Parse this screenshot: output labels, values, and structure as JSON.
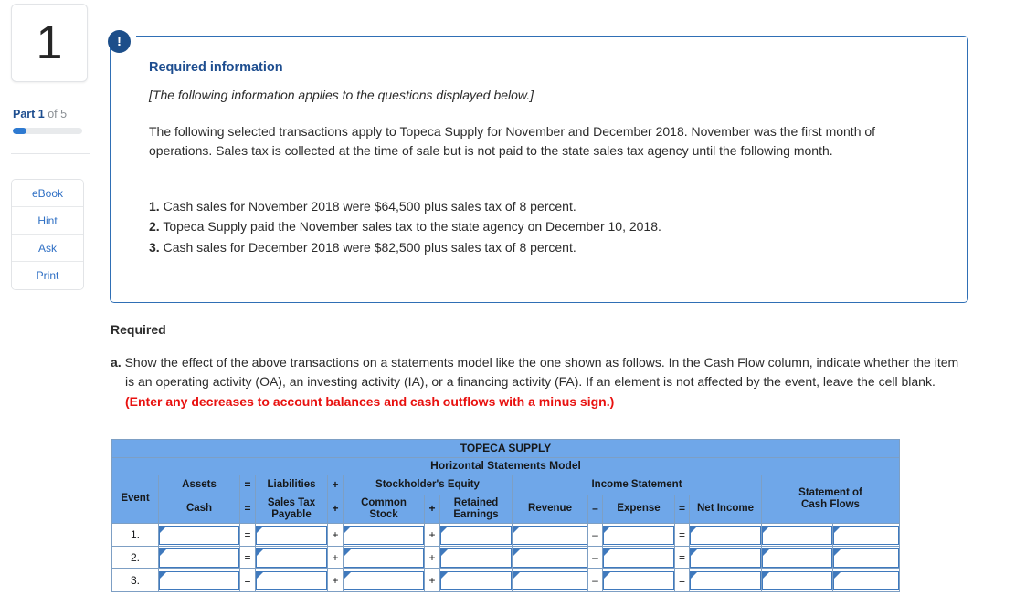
{
  "sidebar": {
    "question_number": "1",
    "part_prefix": "Part 1",
    "part_suffix": " of 5",
    "progress_percent": 20,
    "tools": [
      {
        "label": "eBook",
        "name": "ebook"
      },
      {
        "label": "Hint",
        "name": "hint"
      },
      {
        "label": "Ask",
        "name": "ask"
      },
      {
        "label": "Print",
        "name": "print"
      }
    ]
  },
  "callout": {
    "badge": "!",
    "title": "Required information",
    "italic_note": "[The following information applies to the questions displayed below.]",
    "body": "The following selected transactions apply to Topeca Supply for November and December 2018. November was the first month of operations. Sales tax is collected at the time of sale but is not paid to the state sales tax agency until the following month.",
    "items": [
      {
        "num": "1.",
        "text": "Cash sales for November 2018 were $64,500 plus sales tax of 8 percent."
      },
      {
        "num": "2.",
        "text": "Topeca Supply paid the November sales tax to the state agency on December 10, 2018."
      },
      {
        "num": "3.",
        "text": "Cash sales for December 2018 were $82,500 plus sales tax of 8 percent."
      }
    ]
  },
  "required": {
    "heading": "Required",
    "item_marker": "a.",
    "item_text": "Show the effect of the above transactions on a statements model like the one shown as follows. In the Cash Flow column, indicate whether the item is an operating activity (OA), an investing activity (IA), or a financing activity (FA). If an element is not affected by the event, leave the cell blank. ",
    "item_warning": "(Enter any decreases to account balances and cash outflows with a minus sign.)"
  },
  "table": {
    "company_title": "TOPECA SUPPLY",
    "model_title": "Horizontal Statements Model",
    "event_header": "Event",
    "group_headers": {
      "assets": "Assets",
      "eq1": "=",
      "liabilities": "Liabilities",
      "plus1": "+",
      "stockholders_equity": "Stockholder's Equity",
      "income_statement": "Income Statement",
      "statement_of_cash_flows_line1": "Statement of",
      "statement_of_cash_flows_line2": "Cash Flows"
    },
    "column_headers": {
      "cash": "Cash",
      "eq1": "=",
      "sales_tax_payable_line1": "Sales Tax",
      "sales_tax_payable_line2": "Payable",
      "plus1": "+",
      "common_stock_line1": "Common",
      "common_stock_line2": "Stock",
      "plus2": "+",
      "retained_earnings_line1": "Retained",
      "retained_earnings_line2": "Earnings",
      "revenue": "Revenue",
      "minus": "–",
      "expense": "Expense",
      "eq2": "=",
      "net_income": "Net Income"
    },
    "rows": [
      {
        "event": "1.",
        "cash": "",
        "op_eq1": "=",
        "sales_tax_payable": "",
        "op_plus1": "+",
        "common_stock": "",
        "op_plus2": "+",
        "retained_earnings": "",
        "revenue": "",
        "op_minus": "–",
        "expense": "",
        "op_eq2": "=",
        "net_income": "",
        "cash_flow_amount": "",
        "cash_flow_activity": ""
      },
      {
        "event": "2.",
        "cash": "",
        "op_eq1": "=",
        "sales_tax_payable": "",
        "op_plus1": "+",
        "common_stock": "",
        "op_plus2": "+",
        "retained_earnings": "",
        "revenue": "",
        "op_minus": "–",
        "expense": "",
        "op_eq2": "=",
        "net_income": "",
        "cash_flow_amount": "",
        "cash_flow_activity": ""
      },
      {
        "event": "3.",
        "cash": "",
        "op_eq1": "=",
        "sales_tax_payable": "",
        "op_plus1": "+",
        "common_stock": "",
        "op_plus2": "+",
        "retained_earnings": "",
        "revenue": "",
        "op_minus": "–",
        "expense": "",
        "op_eq2": "=",
        "net_income": "",
        "cash_flow_amount": "",
        "cash_flow_activity": ""
      }
    ]
  },
  "colors": {
    "header_blue": "#6FA7E9",
    "accent_navy": "#1C4E8A",
    "link_blue": "#2E6FC4",
    "warning_red": "#E8110F",
    "field_border": "#3F79BD"
  }
}
